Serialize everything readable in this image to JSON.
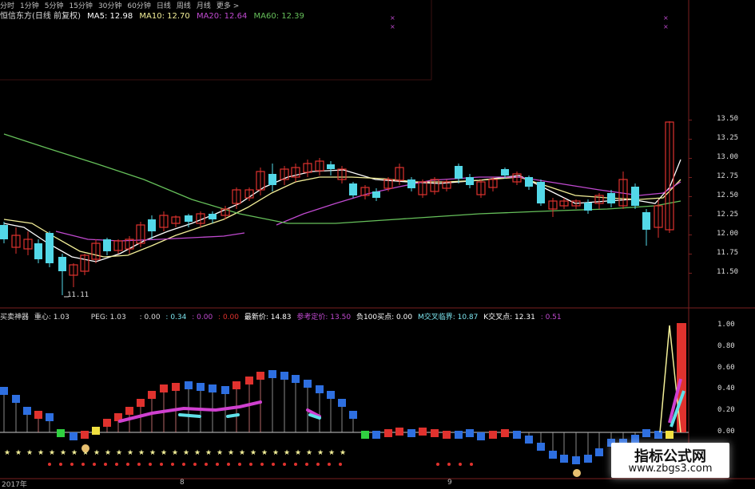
{
  "toolbar": {
    "items": [
      "分时",
      "1分钟",
      "5分钟",
      "15分钟",
      "30分钟",
      "60分钟",
      "日线",
      "周线",
      "月线",
      "更多 >"
    ]
  },
  "legend": {
    "stock": "恒信东方(日线 前复权)",
    "ma5": "MA5: 12.98",
    "ma10": "MA10: 12.70",
    "ma20": "MA20: 12.64",
    "ma60": "MA60: 12.39"
  },
  "price_axis": {
    "ticks": [
      "13.50",
      "13.25",
      "13.00",
      "12.75",
      "12.50",
      "12.25",
      "12.00",
      "11.75",
      "11.50"
    ]
  },
  "low_label": "11.11",
  "indicator": {
    "name": "买卖神器",
    "zhongxin": "重心: 1.03",
    "peg": "PEG: 1.03",
    "v1": ": 0.00",
    "v2": ": 0.34",
    "v3": ": 0.00",
    "v4": ": 0.00",
    "zuixin": "最新价: 14.83",
    "cankao": "参考定价: 13.50",
    "fu100": "负100买点: 0.00",
    "mjiaocha": "M交叉临界: 10.87",
    "kjiaocha": "K交叉点: 12.31",
    "v5": ": 0.51",
    "axis": [
      "1.00",
      "0.80",
      "0.60",
      "0.40",
      "0.20",
      "0.00"
    ]
  },
  "dates": {
    "year": "2017年",
    "m1": "8",
    "m2": "9"
  },
  "watermark": {
    "line1": "指标公式网",
    "line2": "www.zbgs3.com"
  },
  "colors": {
    "up": "#e0322e",
    "down": "#53d8e8",
    "ma5": "#ffffff",
    "ma10": "#f3ef98",
    "ma20": "#c04ad0",
    "ma60": "#66c05a"
  }
}
